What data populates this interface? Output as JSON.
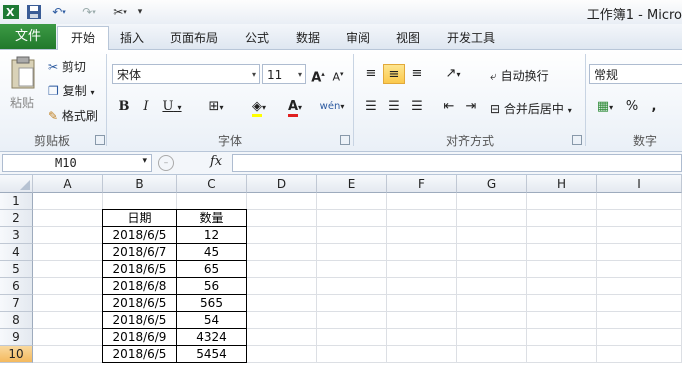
{
  "title": "工作簿1 - Micro",
  "tabs": [
    "文件",
    "开始",
    "插入",
    "页面布局",
    "公式",
    "数据",
    "审阅",
    "视图",
    "开发工具"
  ],
  "clipboard": {
    "paste": "粘贴",
    "cut": "剪切",
    "copy": "复制",
    "format_painter": "格式刷",
    "group": "剪贴板"
  },
  "font": {
    "name": "宋体",
    "size": "11",
    "bold": "B",
    "italic": "I",
    "underline": "U",
    "increase": "A",
    "decrease": "A",
    "group": "字体",
    "phonetic": "wén"
  },
  "alignment": {
    "wrap": "自动换行",
    "merge": "合并后居中",
    "group": "对齐方式"
  },
  "number": {
    "format": "常规",
    "percent": "%",
    "comma": ",",
    "group": "数字"
  },
  "formula_bar": {
    "name_box": "M10",
    "fx": "fx",
    "value": ""
  },
  "columns": [
    "A",
    "B",
    "C",
    "D",
    "E",
    "F",
    "G",
    "H",
    "I"
  ],
  "rows": [
    "1",
    "2",
    "3",
    "4",
    "5",
    "6",
    "7",
    "8",
    "9",
    "10"
  ],
  "table": {
    "header": [
      "日期",
      "数量"
    ],
    "rows": [
      [
        "2018/6/5",
        "12"
      ],
      [
        "2018/6/7",
        "45"
      ],
      [
        "2018/6/5",
        "65"
      ],
      [
        "2018/6/8",
        "56"
      ],
      [
        "2018/6/5",
        "565"
      ],
      [
        "2018/6/5",
        "54"
      ],
      [
        "2018/6/9",
        "4324"
      ],
      [
        "2018/6/5",
        "5454"
      ]
    ]
  },
  "selected_cell": "M10",
  "colors": {
    "file_tab": "#2a8a35",
    "selected_row": "#f4b95e",
    "active_button": "#fbc94c"
  }
}
